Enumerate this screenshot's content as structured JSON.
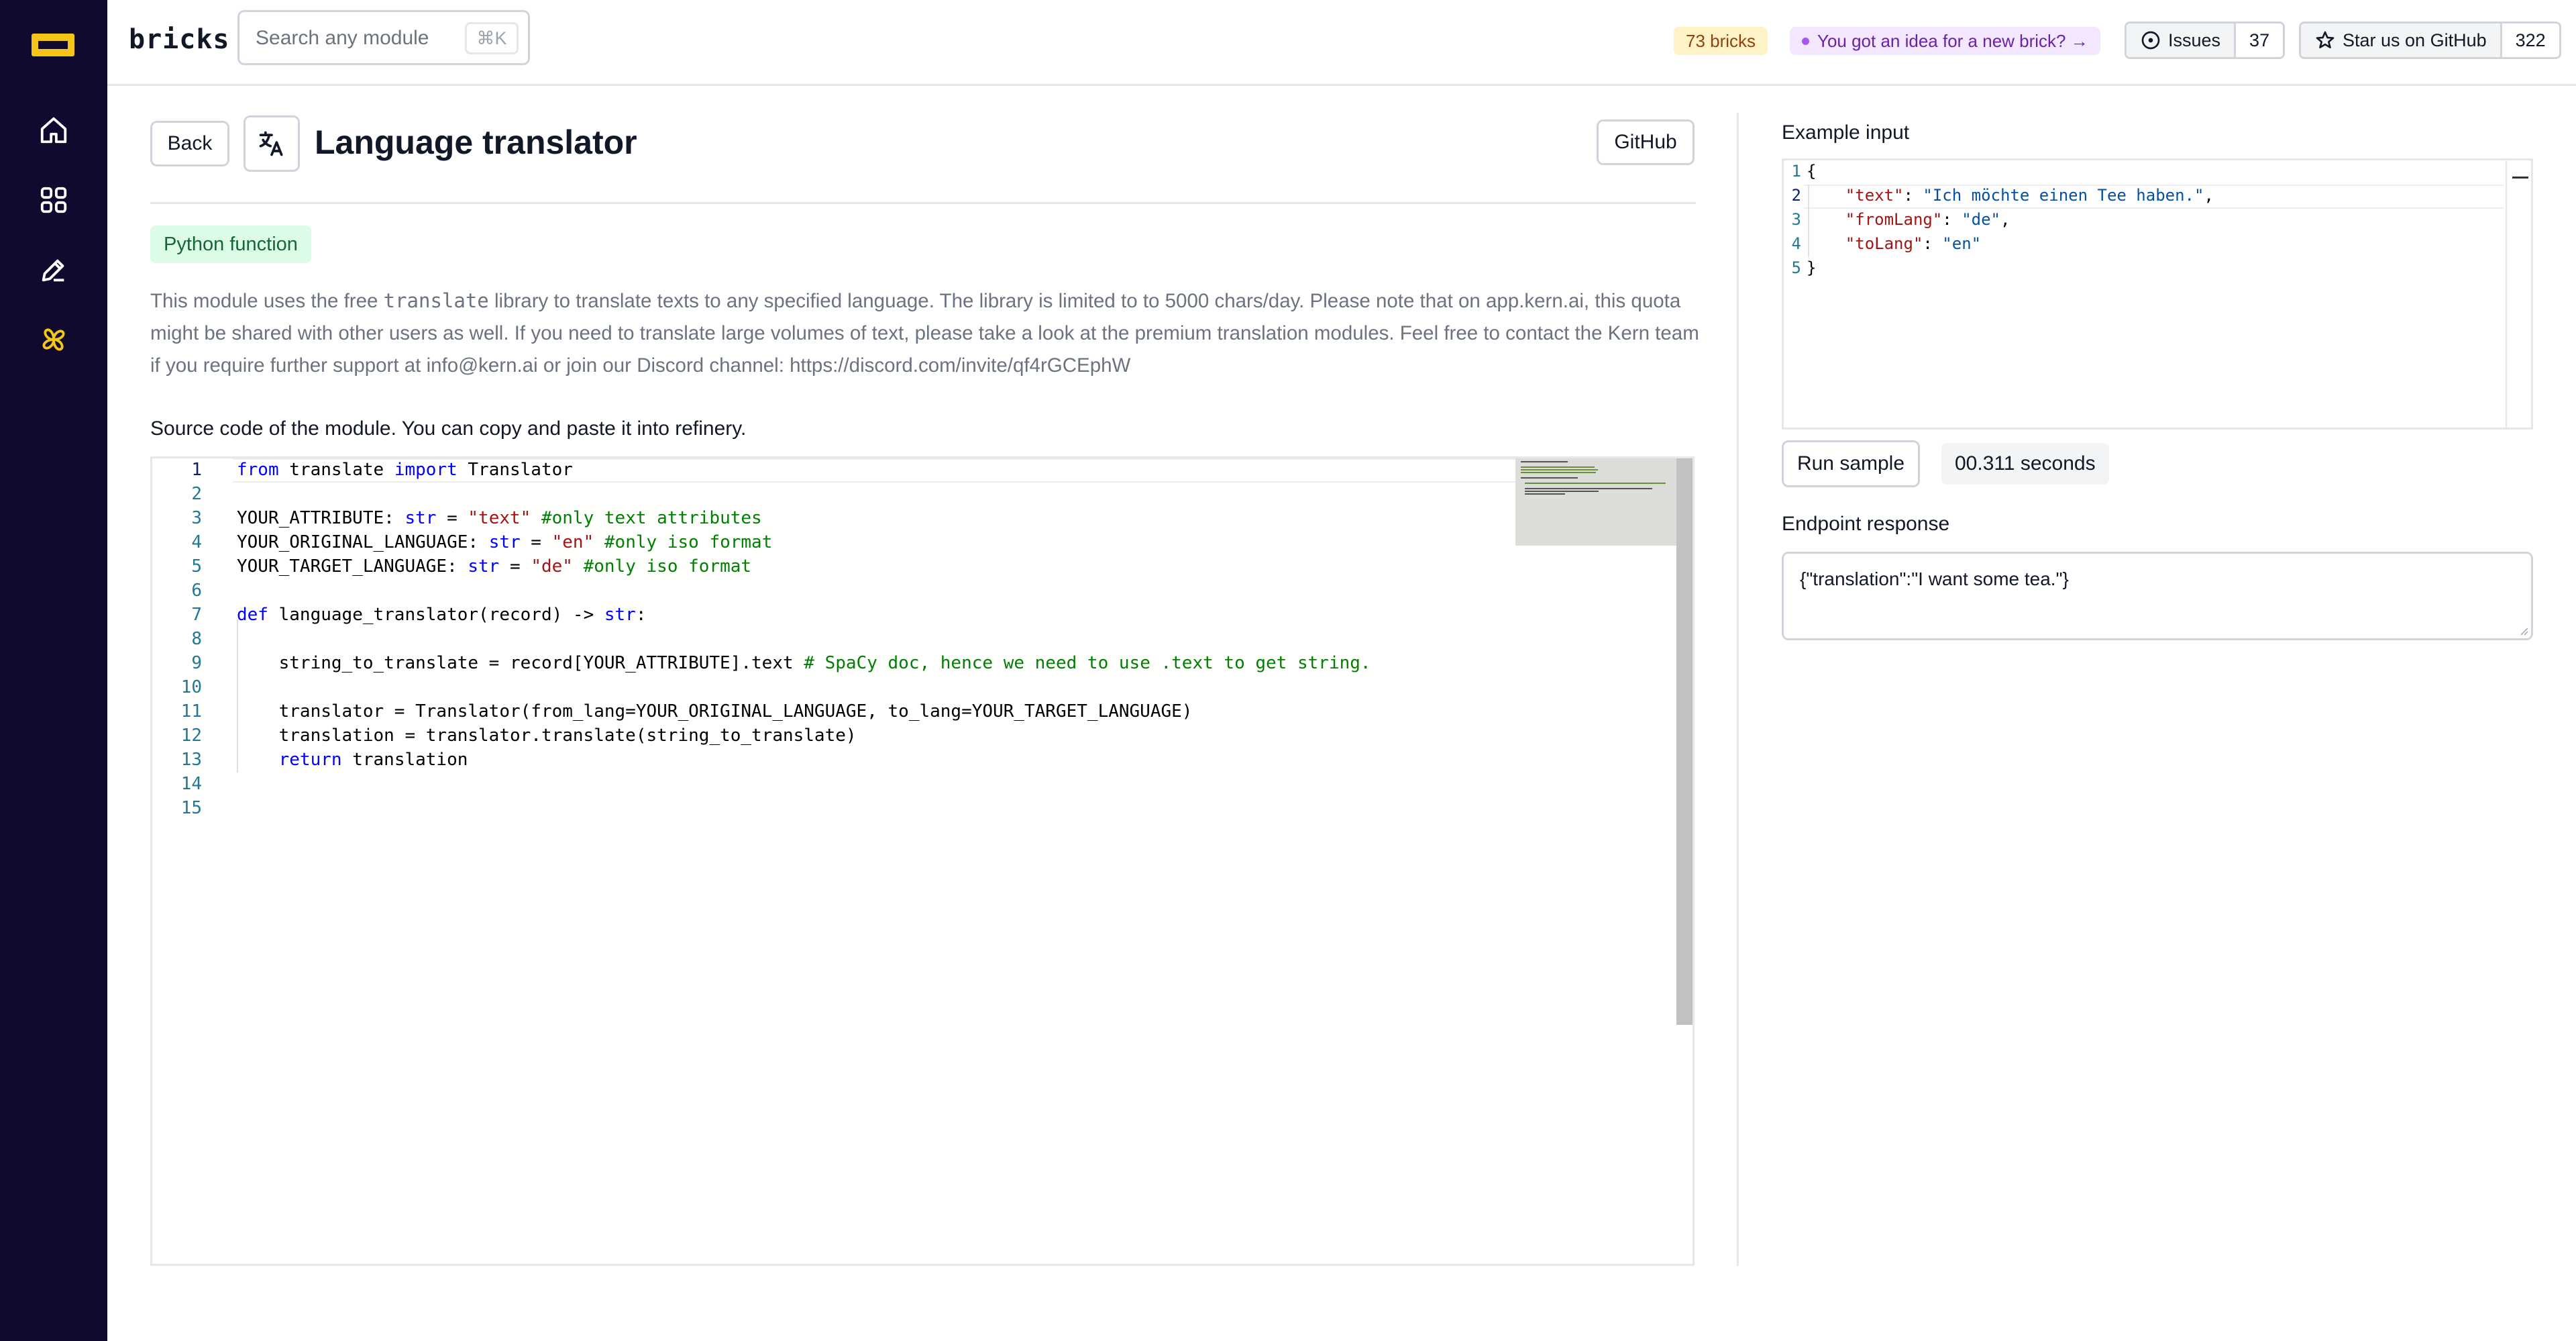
{
  "header": {
    "brand": "bricks",
    "search_placeholder": "Search any module",
    "search_shortcut": "⌘K",
    "bricks_count": "73 bricks",
    "idea_link": "You got an idea for a new brick? →",
    "issues_label": "Issues",
    "issues_count": "37",
    "star_label": "Star us on GitHub",
    "star_count": "322"
  },
  "sidebar": {
    "items": [
      {
        "icon": "home-icon"
      },
      {
        "icon": "grid-icon"
      },
      {
        "icon": "pencil-icon"
      },
      {
        "icon": "pinwheel-icon"
      }
    ],
    "accent": "#f5c518"
  },
  "main": {
    "back_label": "Back",
    "title": "Language translator",
    "github_label": "GitHub",
    "type_badge": "Python function",
    "description": {
      "part1": "This module uses the free ",
      "code": "translate",
      "part2": " library to translate texts to any specified language. The library is limited to to 5000 chars/day. Please note that on app.kern.ai, this quota might be shared with other users as well. If you need to translate large volumes of text, please take a look at the premium translation modules. Feel free to contact the Kern team if you require further support at info@kern.ai or join our Discord channel: https://discord.com/invite/qf4rGCEphW"
    },
    "source_label": "Source code of the module. You can copy and paste it into refinery.",
    "code_lines": [
      "from translate import Translator",
      "",
      "YOUR_ATTRIBUTE: str = \"text\" #only text attributes",
      "YOUR_ORIGINAL_LANGUAGE: str = \"en\" #only iso format",
      "YOUR_TARGET_LANGUAGE: str = \"de\" #only iso format",
      "",
      "def language_translator(record) -> str:",
      "",
      "    string_to_translate = record[YOUR_ATTRIBUTE].text # SpaCy doc, hence we need to use .text to get string.",
      "",
      "    translator = Translator(from_lang=YOUR_ORIGINAL_LANGUAGE, to_lang=YOUR_TARGET_LANGUAGE)",
      "    translation = translator.translate(string_to_translate)",
      "    return translation",
      "",
      ""
    ],
    "line_numbers": [
      "1",
      "2",
      "3",
      "4",
      "5",
      "6",
      "7",
      "8",
      "9",
      "10",
      "11",
      "12",
      "13",
      "14",
      "15"
    ]
  },
  "right": {
    "example_label": "Example input",
    "json_line_numbers": [
      "1",
      "2",
      "3",
      "4",
      "5"
    ],
    "json_lines": [
      "{",
      "    \"text\": \"Ich möchte einen Tee haben.\",",
      "    \"fromLang\": \"de\",",
      "    \"toLang\": \"en\"",
      "}"
    ],
    "run_label": "Run sample",
    "run_time": "00.311 seconds",
    "response_label": "Endpoint response",
    "response_value": "{\"translation\":\"I want some tea.\"}"
  }
}
